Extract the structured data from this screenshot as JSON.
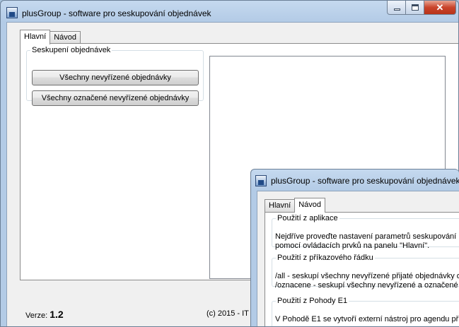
{
  "main_window": {
    "title": "plusGroup - software pro seskupování objednávek",
    "tabs": [
      {
        "label": "Hlavní"
      },
      {
        "label": "Návod"
      }
    ],
    "group": {
      "legend": "Seskupení objednávek",
      "btn_all": "Všechny nevyřízené objednávky",
      "btn_marked": "Všechny označené nevyřízené objednávky"
    },
    "status": {
      "version_label": "Verze:",
      "version_value": "1.2",
      "copyright": "(c) 2015 - IT"
    }
  },
  "overlay_window": {
    "title": "plusGroup - software pro seskupování objednávek",
    "tabs": [
      {
        "label": "Hlavní"
      },
      {
        "label": "Návod"
      }
    ],
    "sections": [
      {
        "legend": "Použití z aplikace",
        "lines": [
          "Nejdříve proveďte nastavení parametrů seskupování",
          "pomocí ovládacích prvků na panelu \"Hlavní\"."
        ]
      },
      {
        "legend": "Použití z příkazového řádku",
        "lines": [
          "/all - seskupí všechny nevyřízené přijaté objednávky d",
          "/oznacene - seskupí všechny nevyřízené a označené"
        ]
      },
      {
        "legend": "Použití z Pohody E1",
        "lines": [
          "V Pohodě E1 se vytvoří externí nástroj pro agendu př"
        ]
      }
    ]
  }
}
